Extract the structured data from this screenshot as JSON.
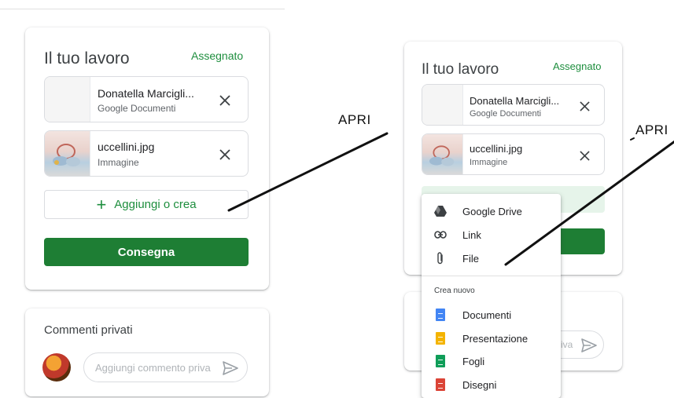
{
  "left": {
    "work": {
      "title": "Il tuo lavoro",
      "status": "Assegnato",
      "attachments": [
        {
          "name": "Donatella Marcigli...",
          "type": "Google Documenti"
        },
        {
          "name": "uccellini.jpg",
          "type": "Immagine"
        }
      ],
      "add_label": "Aggiungi o crea",
      "submit_label": "Consegna"
    },
    "comments": {
      "title": "Commenti privati",
      "placeholder": "Aggiungi commento priva"
    }
  },
  "right": {
    "work": {
      "title": "Il tuo lavoro",
      "status": "Assegnato",
      "attachments": [
        {
          "name": "Donatella Marcigli...",
          "type": "Google Documenti"
        },
        {
          "name": "uccellini.jpg",
          "type": "Immagine"
        }
      ]
    },
    "comment_placeholder_fragment": "riva",
    "menu": {
      "items": [
        {
          "label": "Google Drive",
          "icon": "google-drive-icon"
        },
        {
          "label": "Link",
          "icon": "link-icon"
        },
        {
          "label": "File",
          "icon": "paperclip-icon"
        }
      ],
      "section_label": "Crea nuovo",
      "create_items": [
        {
          "label": "Documenti",
          "icon": "docs-icon",
          "color": "#4285f4"
        },
        {
          "label": "Presentazione",
          "icon": "slides-icon",
          "color": "#f4b400"
        },
        {
          "label": "Fogli",
          "icon": "sheets-icon",
          "color": "#0f9d58"
        },
        {
          "label": "Disegni",
          "icon": "drawings-icon",
          "color": "#db4437"
        }
      ]
    }
  },
  "annotations": {
    "left": "APRI",
    "right": "APRI"
  },
  "colors": {
    "accent": "#1e8e3e",
    "submit": "#1e7e34"
  }
}
